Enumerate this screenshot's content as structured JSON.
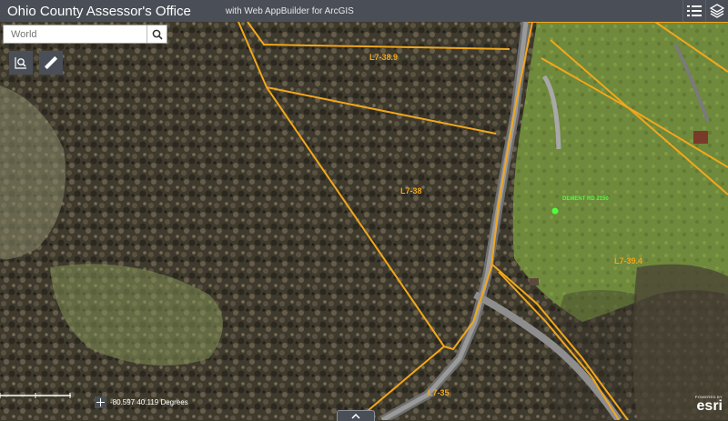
{
  "header": {
    "title": "Ohio County Assessor's Office",
    "subtitle": "with Web AppBuilder for ArcGIS",
    "icons": [
      "layer-list-icon",
      "basemap-layers-icon"
    ]
  },
  "search": {
    "placeholder": "World",
    "value": ""
  },
  "tools": [
    "zoom-to-parcel-icon",
    "measure-ruler-icon"
  ],
  "parcels": [
    {
      "id": "L7-38.9"
    },
    {
      "id": "L7-38"
    },
    {
      "id": "L7-39.4"
    },
    {
      "id": "L7-35"
    }
  ],
  "address_point": {
    "label": "DEMENT RD 2150",
    "color": "#4dff3d"
  },
  "coordinates": {
    "text": "-80.597 40.119 Degrees"
  },
  "attribution": {
    "powered_by": "POWERED BY",
    "brand": "esri"
  },
  "colors": {
    "parcel_line": "#f2a71b",
    "header_bg": "#4a4f57"
  }
}
